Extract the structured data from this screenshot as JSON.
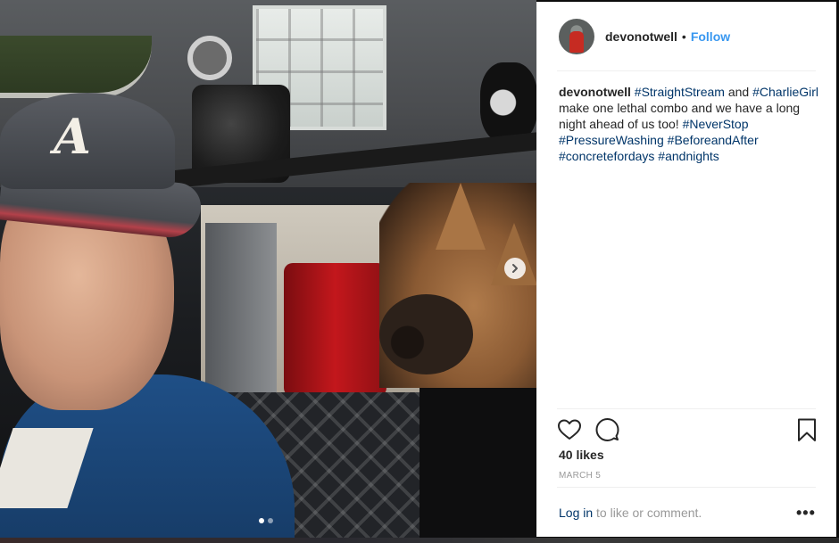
{
  "post": {
    "username": "devonotwell",
    "separator": "•",
    "follow_label": "Follow",
    "caption": {
      "username": "devonotwell",
      "parts": [
        {
          "text": "#StraightStream",
          "tag": true
        },
        {
          "text": " and ",
          "tag": false
        },
        {
          "text": "#CharlieGirl",
          "tag": true
        },
        {
          "text": " make one lethal combo and we have a long night ahead of us too! ",
          "tag": false
        },
        {
          "text": "#NeverStop",
          "tag": true
        },
        {
          "text": " ",
          "tag": false
        },
        {
          "text": "#PressureWashing",
          "tag": true
        },
        {
          "text": " ",
          "tag": false
        },
        {
          "text": "#BeforeandAfter",
          "tag": true
        },
        {
          "text": " ",
          "tag": false
        },
        {
          "text": "#concretefordays",
          "tag": true
        },
        {
          "text": " ",
          "tag": false
        },
        {
          "text": "#andnights",
          "tag": true
        }
      ]
    },
    "likes_label": "40 likes",
    "date_label": "MARCH 5",
    "login": {
      "link_label": "Log in",
      "suffix": " to like or comment."
    },
    "more_label": "•••"
  },
  "carousel": {
    "dot_count": 2,
    "active_index": 0
  },
  "colors": {
    "link": "#3897f0",
    "hashtag": "#003569",
    "text": "#262626",
    "muted": "#999999"
  }
}
